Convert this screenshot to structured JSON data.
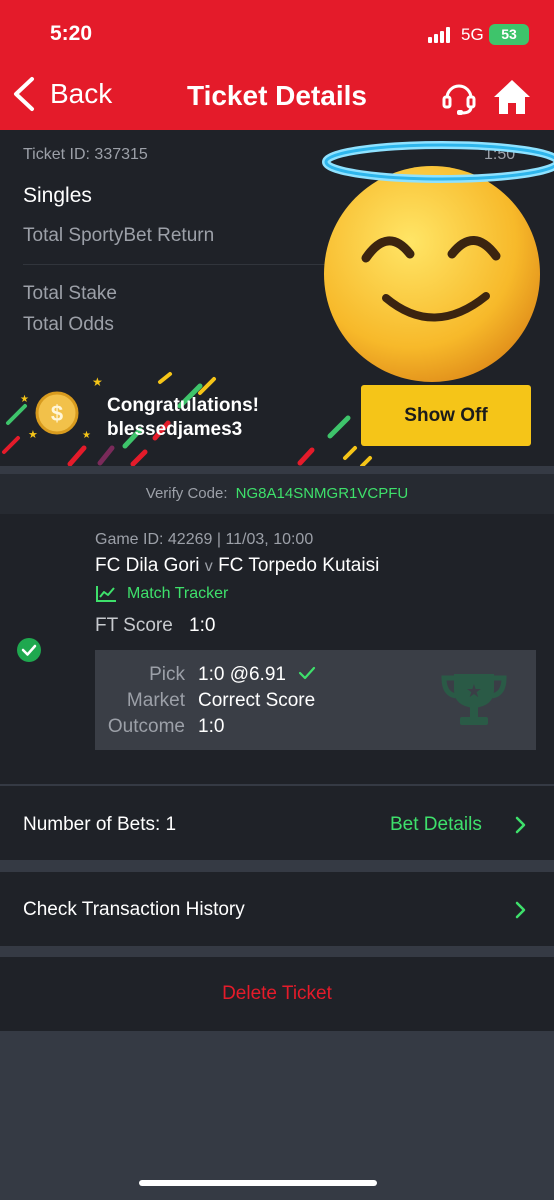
{
  "status_bar": {
    "time": "5:20",
    "network": "5G",
    "battery": "53"
  },
  "header": {
    "back_label": "Back",
    "title": "Ticket Details"
  },
  "ticket": {
    "id": "Ticket ID: 337315",
    "date_partial": "1:50",
    "bet_type": "Singles",
    "return_label": "Total SportyBet Return",
    "stake_label": "Total Stake",
    "odds_label": "Total Odds"
  },
  "congrats": {
    "line1": "Congratulations!",
    "line2": "blessedjames3",
    "button_label": "Show Off"
  },
  "verify": {
    "label": "Verify Code:",
    "code": "NG8A14SNMGR1VCPFU"
  },
  "game": {
    "meta": "Game ID: 42269 | 11/03, 10:00",
    "home": "FC Dila Gori",
    "vs": "v",
    "away": "FC Torpedo Kutaisi",
    "tracker_label": "Match Tracker",
    "ft_label": "FT Score",
    "ft_value": "1:0",
    "pick_label": "Pick",
    "pick_value": "1:0 @6.91",
    "market_label": "Market",
    "market_value": "Correct Score",
    "outcome_label": "Outcome",
    "outcome_value": "1:0"
  },
  "rows": {
    "bets_label": "Number of Bets: 1",
    "bet_details_label": "Bet Details",
    "history_label": "Check Transaction History",
    "delete_label": "Delete Ticket"
  },
  "colors": {
    "brand": "#e41b2a",
    "accent_green": "#3ee06b",
    "button_yellow": "#f5c518"
  }
}
